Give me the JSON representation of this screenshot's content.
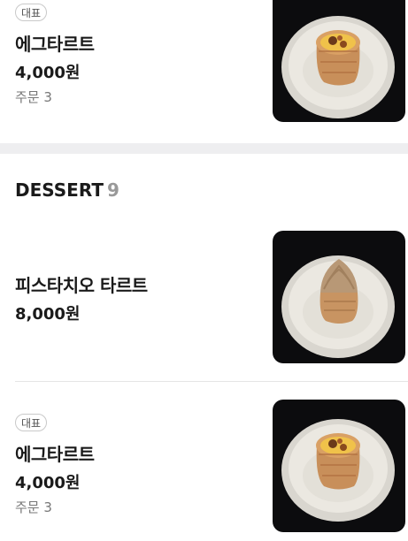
{
  "items_top": {
    "badge": "대표",
    "name": "에그타르트",
    "price": "4,000원",
    "orders": "주문 3"
  },
  "section": {
    "title": "DESSERT",
    "count": "9"
  },
  "items_dessert": [
    {
      "name": "피스타치오 타르트",
      "price": "8,000원"
    },
    {
      "badge": "대표",
      "name": "에그타르트",
      "price": "4,000원",
      "orders": "주문 3"
    }
  ],
  "images": {
    "egg_tart": "egg-tart-photo",
    "pistachio_tart": "pistachio-tart-photo"
  },
  "colors": {
    "photo_background": "#0c0c0e",
    "section_band": "#eeeef0",
    "count": "#999999"
  }
}
